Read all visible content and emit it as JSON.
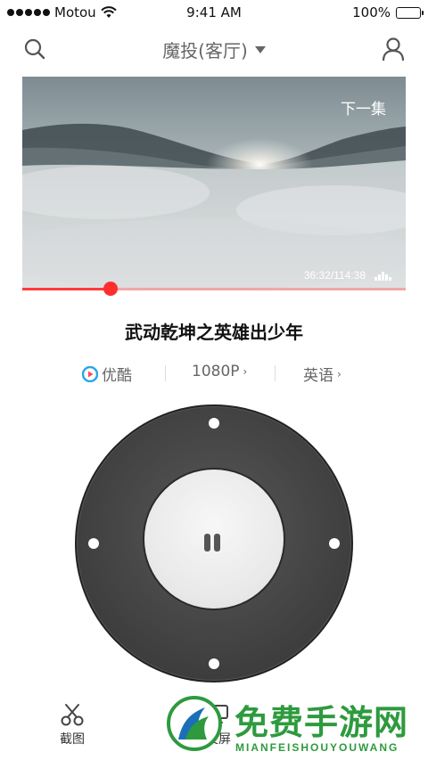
{
  "status_bar": {
    "carrier": "Motou",
    "time": "9:41 AM",
    "battery": "100%",
    "battery_level": 1.0
  },
  "header": {
    "title": "魔投(客厅)",
    "search_icon": "search-icon",
    "user_icon": "user-icon"
  },
  "video": {
    "next_episode_label": "下一集",
    "timecode": "36:32/114:38",
    "progress": 0.23
  },
  "show": {
    "title": "武动乾坤之英雄出少年"
  },
  "options": {
    "source_label": "优酷",
    "quality_label": "1080P",
    "language_label": "英语",
    "chevron": "›"
  },
  "remote": {
    "center_icon": "pause-icon"
  },
  "tabs": [
    {
      "label": "截图",
      "icon": "scissors-icon"
    },
    {
      "label": "投屏",
      "icon": "cast-icon"
    }
  ],
  "watermark": {
    "title": "免费手游网",
    "subtitle": "MIANFEISHOUYOUWANG"
  },
  "colors": {
    "accent_red": "#ff2e2e",
    "remote_dark": "#474747",
    "watermark_green": "#2e9a3e"
  }
}
